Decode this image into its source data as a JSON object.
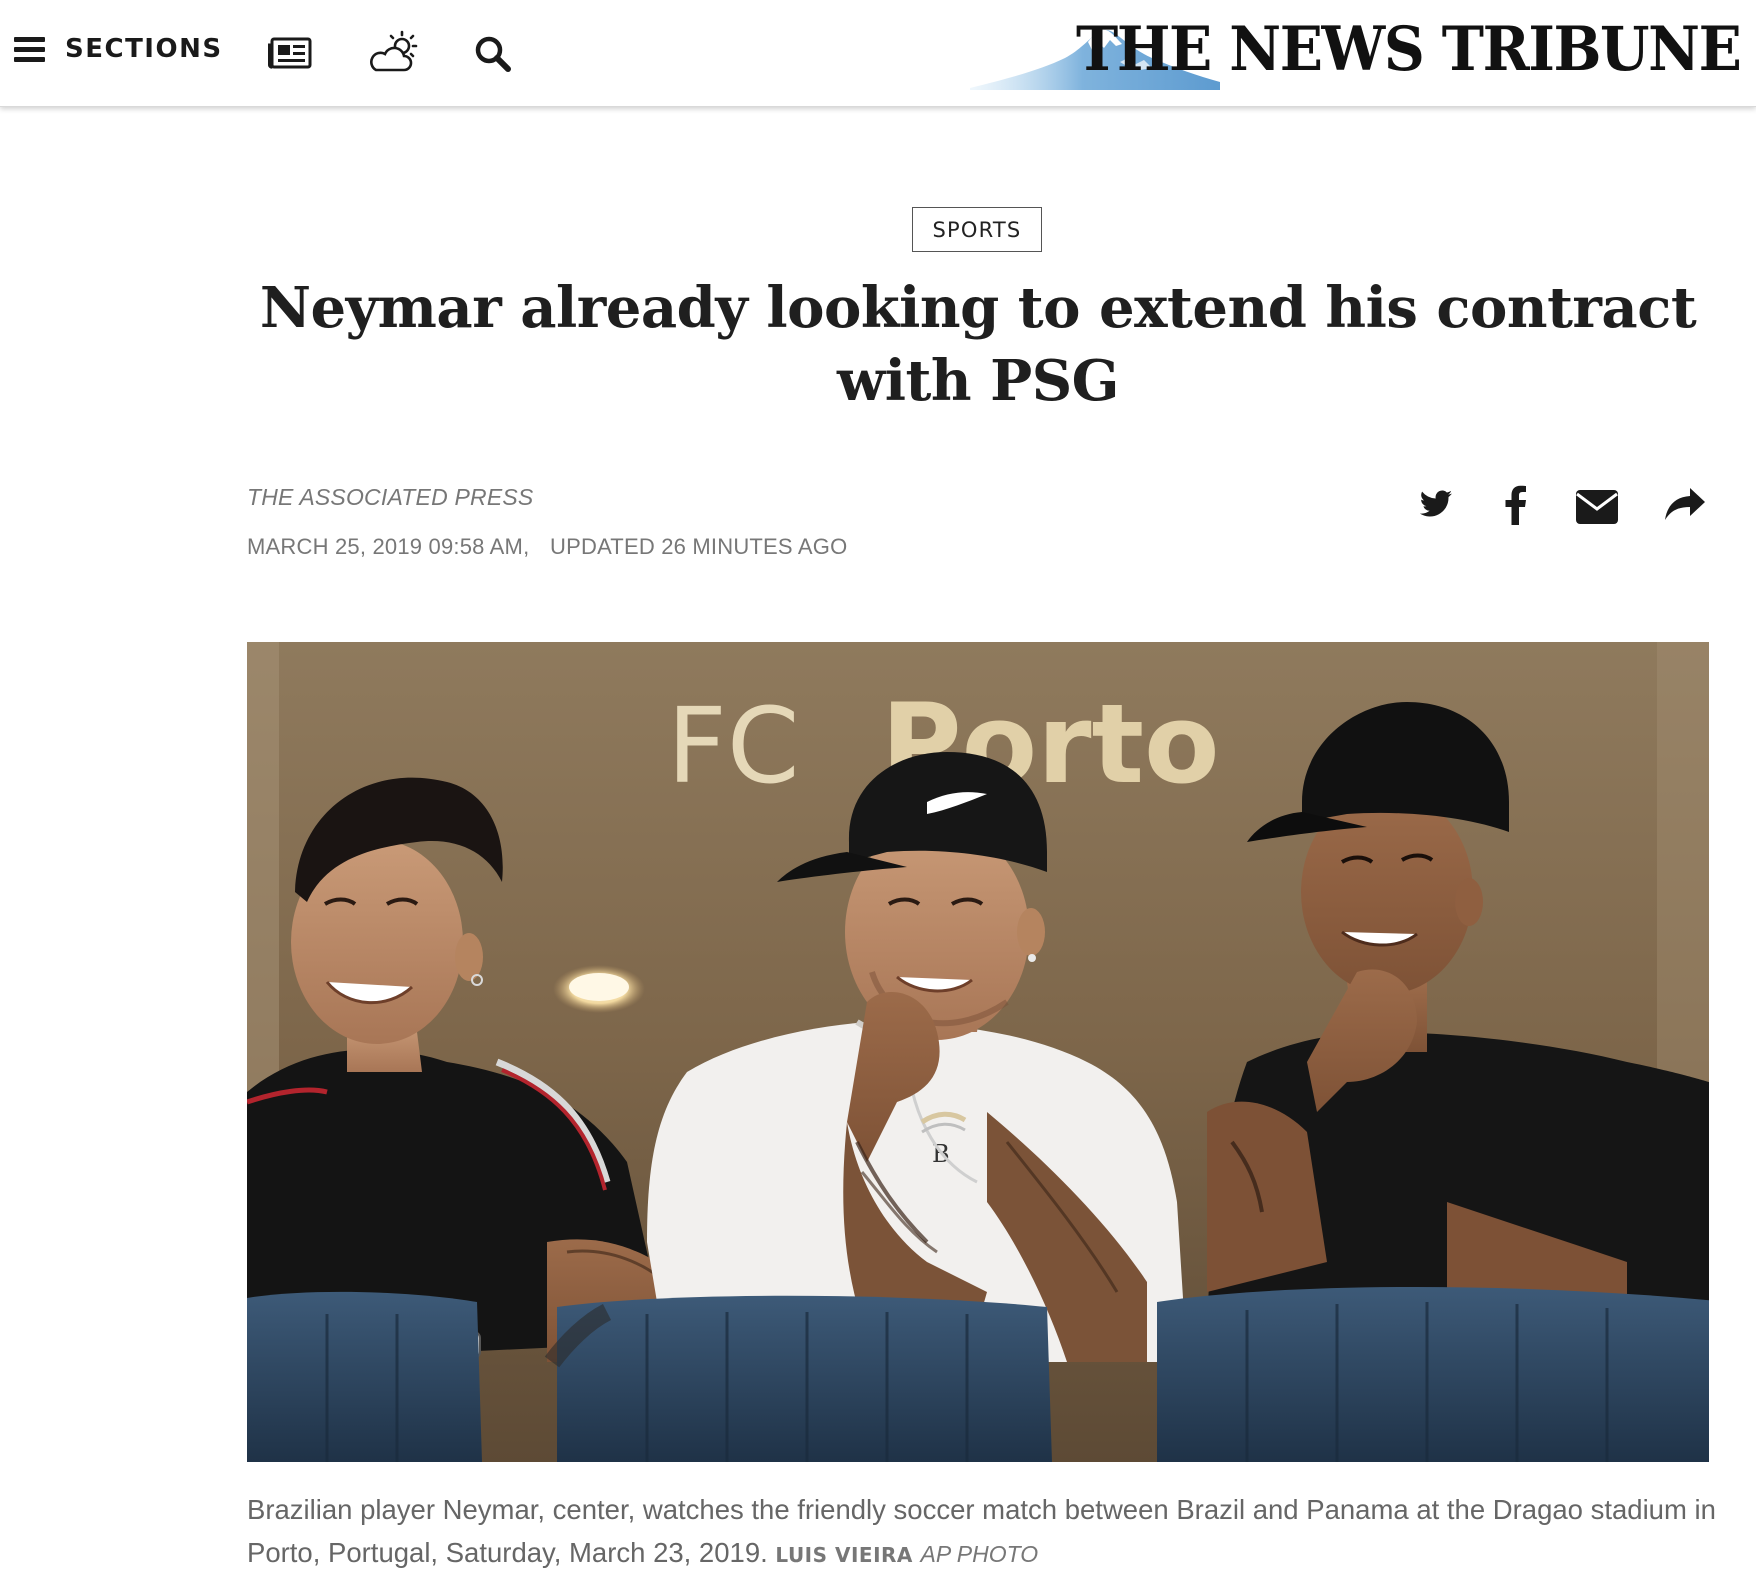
{
  "header": {
    "sections_label": "SECTIONS",
    "brand_name": "THE NEWS TRIBUNE",
    "icons": [
      "menu-icon",
      "newspaper-icon",
      "weather-icon",
      "search-icon"
    ]
  },
  "article": {
    "section_tag": "SPORTS",
    "headline": "Neymar already looking to extend his contract with PSG",
    "byline": "THE ASSOCIATED PRESS",
    "published": "MARCH 25, 2019 09:58 AM,",
    "updated": "UPDATED 26 MINUTES AGO",
    "share_icons": [
      "twitter-icon",
      "facebook-icon",
      "email-icon",
      "share-icon"
    ]
  },
  "photo": {
    "signage_thin": "FC",
    "signage_bold": "Porto",
    "caption": "Brazilian player Neymar, center, watches the friendly soccer match between Brazil and Panama at the Dragao stadium in Porto, Portugal, Saturday, March 23, 2019.",
    "credit_name": "LUIS VIEIRA",
    "credit_agency": "AP PHOTO"
  },
  "colors": {
    "text_dark": "#1f1f1f",
    "text_meta": "#777777",
    "mountain_blue": "#8fbde0",
    "photo_wall": "#7a6449",
    "seat_blue": "#2f4a66"
  }
}
